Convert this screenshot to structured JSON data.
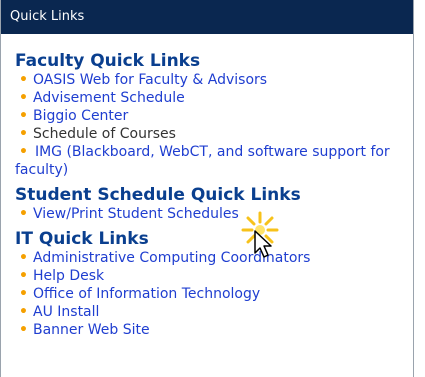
{
  "header": {
    "title": "Quick Links"
  },
  "sections": [
    {
      "title": "Faculty Quick Links",
      "items": [
        "OASIS Web for Faculty & Advisors",
        "Advisement Schedule",
        "Biggio Center",
        "Schedule of Courses",
        "IMG (Blackboard, WebCT, and software support for faculty)"
      ]
    },
    {
      "title": "Student Schedule Quick Links",
      "items": [
        "View/Print Student Schedules"
      ]
    },
    {
      "title": "IT Quick Links",
      "items": [
        "Administrative Computing Coordinators",
        "Help Desk",
        "Office of Information Technology",
        "AU Install",
        "Banner Web Site"
      ]
    }
  ],
  "colors": {
    "header_bg": "#0a2750",
    "section_title": "#0a3f8f",
    "link": "#1f3ed0",
    "bullet": "#f5a000"
  },
  "icons": {
    "bullet": "bullet-icon",
    "cursor": "mouse-pointer-icon",
    "click": "click-burst-icon"
  }
}
